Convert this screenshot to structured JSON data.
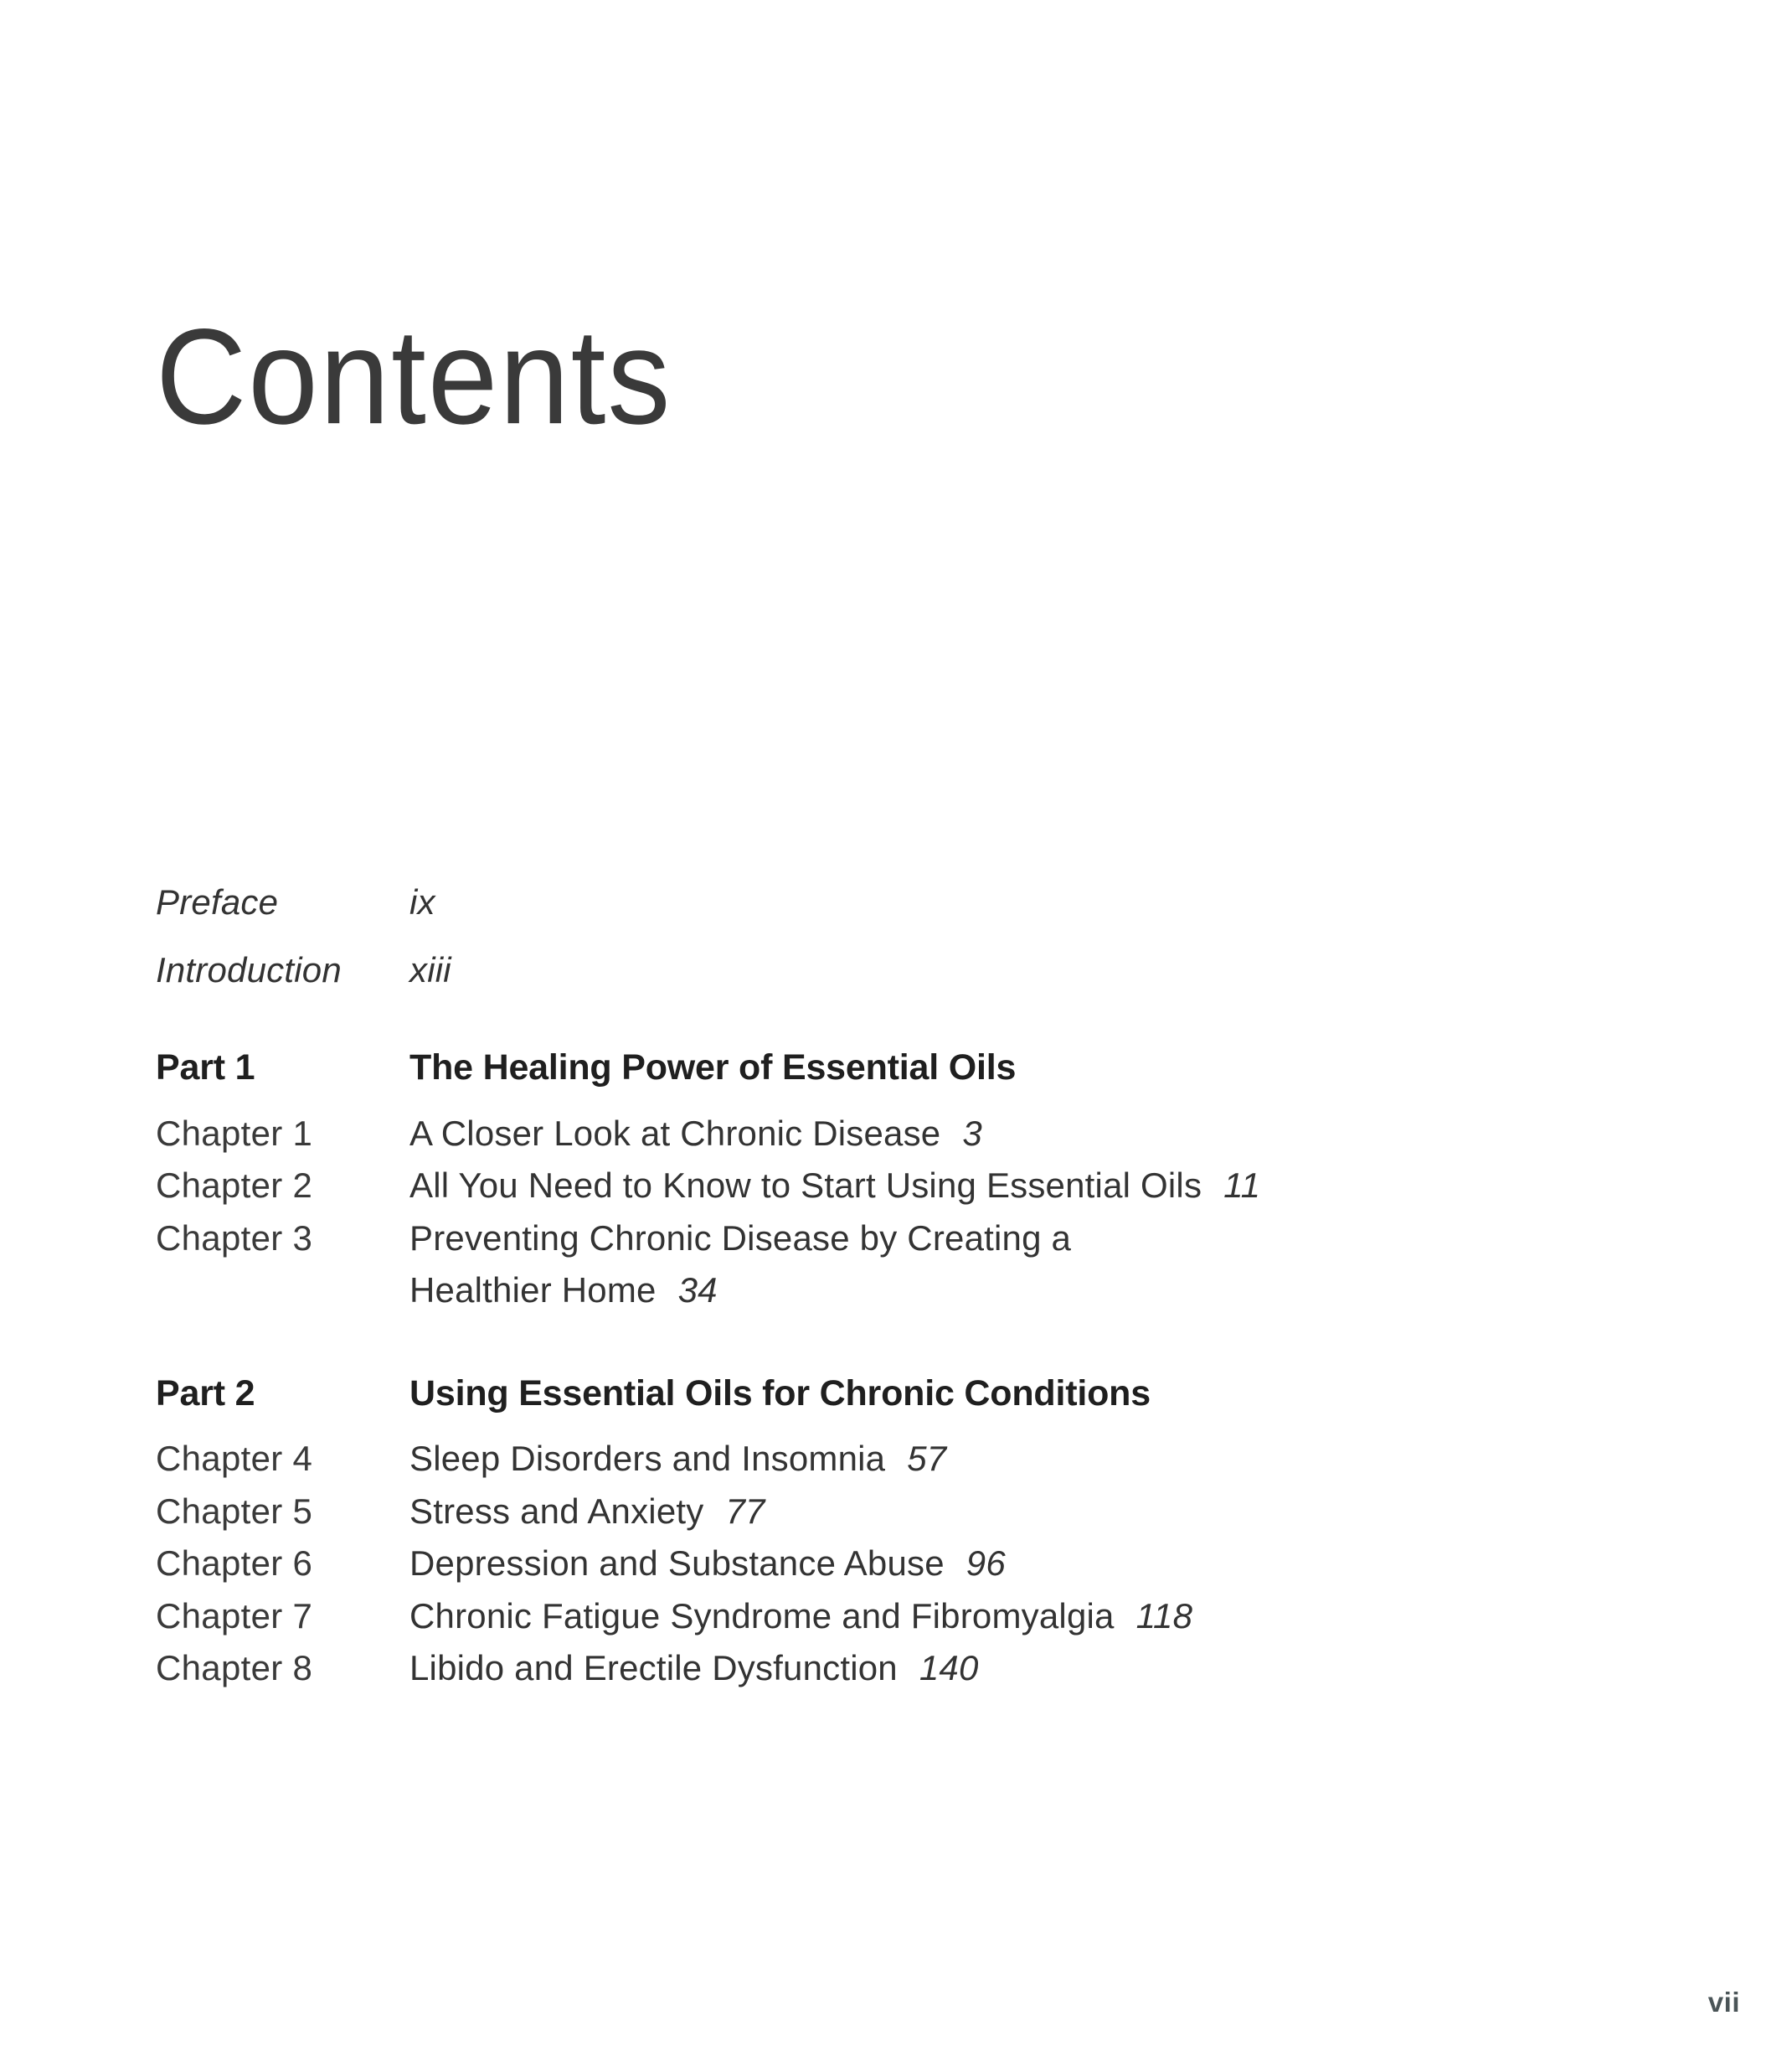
{
  "page": {
    "title": "Contents",
    "folio": "vii"
  },
  "frontmatter": [
    {
      "label": "Preface",
      "page": "ix"
    },
    {
      "label": "Introduction",
      "page": "xiii"
    }
  ],
  "parts": [
    {
      "label": "Part 1",
      "title": "The Healing Power of Essential Oils",
      "chapters": [
        {
          "label": "Chapter 1",
          "lines": [
            "A Closer Look at Chronic Disease"
          ],
          "page": "3"
        },
        {
          "label": "Chapter 2",
          "lines": [
            "All You Need to Know to Start Using Essential Oils"
          ],
          "page": "11"
        },
        {
          "label": "Chapter 3",
          "lines": [
            "Preventing Chronic Disease by Creating a",
            "Healthier Home"
          ],
          "page": "34"
        }
      ]
    },
    {
      "label": "Part 2",
      "title": "Using Essential Oils for Chronic Conditions",
      "chapters": [
        {
          "label": "Chapter 4",
          "lines": [
            "Sleep Disorders and Insomnia"
          ],
          "page": "57"
        },
        {
          "label": "Chapter 5",
          "lines": [
            "Stress and Anxiety"
          ],
          "page": "77"
        },
        {
          "label": "Chapter 6",
          "lines": [
            "Depression and Substance Abuse"
          ],
          "page": "96"
        },
        {
          "label": "Chapter 7",
          "lines": [
            "Chronic Fatigue Syndrome and Fibromyalgia"
          ],
          "page": "118"
        },
        {
          "label": "Chapter 8",
          "lines": [
            "Libido and Erectile Dysfunction"
          ],
          "page": "140"
        }
      ]
    }
  ]
}
